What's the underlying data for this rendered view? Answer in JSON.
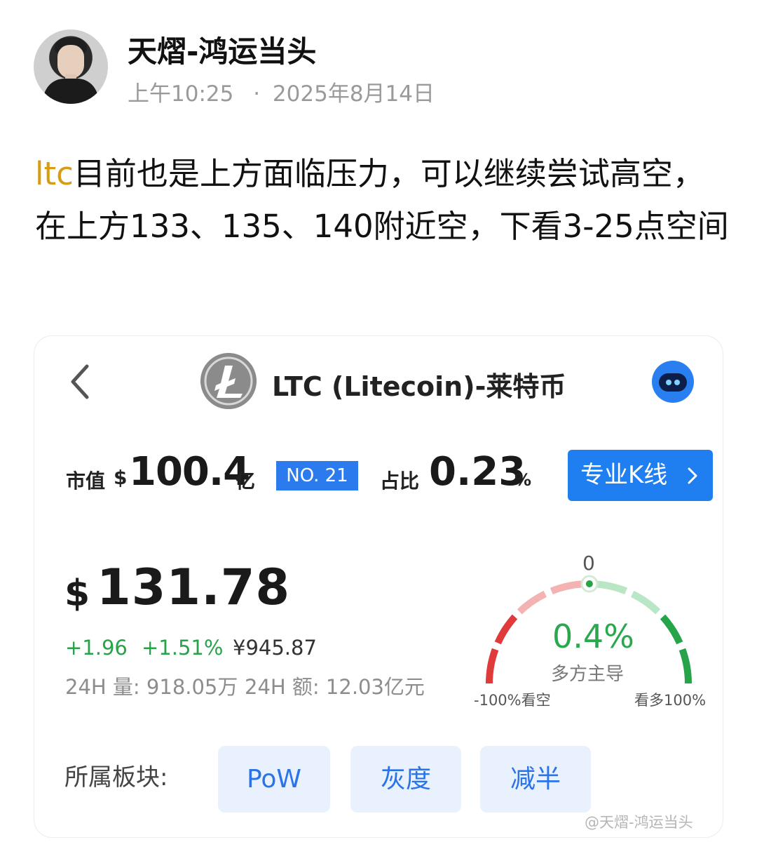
{
  "post": {
    "author": "天熠-鸿运当头",
    "time": "上午10:25",
    "separator": "·",
    "date": "2025年8月14日",
    "text_tag": "ltc",
    "text_body": "目前也是上方面临压力，可以继续尝试高空，在上方133、135、140附近空，下看3-25点空间"
  },
  "card": {
    "title": "LTC (Litecoin)-莱特币",
    "icons": {
      "back": "chevron-left-icon",
      "coin": "litecoin-logo-icon",
      "assistant": "robot-assistant-icon"
    },
    "market_cap": {
      "label": "市值",
      "currency": "$",
      "value": "100.4",
      "unit": "亿"
    },
    "rank": "NO. 21",
    "share": {
      "label": "占比",
      "value": "0.23",
      "unit": "%"
    },
    "kline_button": "专业K线",
    "price": {
      "currency": "$",
      "value": "131.78"
    },
    "change_abs": "+1.96",
    "change_pct": "+1.51%",
    "price_cny": "¥945.87",
    "volume_24h": "24H 量: 918.05万",
    "amount_24h": "24H 额: 12.03亿元",
    "sentiment": {
      "zero_label": "0",
      "value_text": "0.4%",
      "value": 0.4,
      "range": [
        -100,
        100
      ],
      "dominance": "多方主导",
      "left_label": "-100%看空",
      "right_label": "看多100%",
      "colors": {
        "bear": "#e03a3a",
        "bear_light": "#f3b3b3",
        "bull_light": "#b9e6c4",
        "bull": "#27a34a"
      }
    },
    "sector_label": "所属板块:",
    "sectors": [
      "PoW",
      "灰度",
      "减半"
    ],
    "watermark": "@天熠-鸿运当头"
  },
  "colors": {
    "accent_blue": "#1f7ff0",
    "up_green": "#27a34a",
    "tag_gold": "#d79b14"
  }
}
